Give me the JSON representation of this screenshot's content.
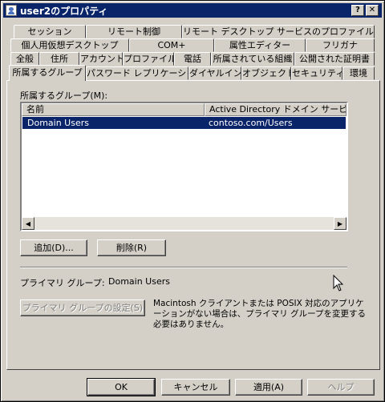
{
  "window": {
    "title": "user2のプロパティ",
    "help_button": "?",
    "close_button": "✕"
  },
  "tabs": {
    "row1": [
      "セッション",
      "リモート制御",
      "リモート デスクトップ サービスのプロファイル"
    ],
    "row2": [
      "個人用仮想デスクトップ",
      "COM+",
      "属性エディター",
      "フリガナ"
    ],
    "row3": [
      "全般",
      "住所",
      "アカウント",
      "プロファイル",
      "電話",
      "所属されている組織",
      "公開された証明書"
    ],
    "row4": [
      "所属するグループ",
      "パスワード レプリケーション",
      "ダイヤルイン",
      "オブジェクト",
      "セキュリティ",
      "環境"
    ],
    "active": "所属するグループ"
  },
  "members": {
    "label": "所属するグループ(M):",
    "columns": [
      "名前",
      "Active Directory ドメイン サービス フォルダー"
    ],
    "rows": [
      {
        "name": "Domain Users",
        "folder": "contoso.com/Users",
        "selected": true
      }
    ]
  },
  "buttons": {
    "add": "追加(D)...",
    "remove": "削除(R)",
    "set_primary": "プライマリ グループの設定(S)",
    "ok": "OK",
    "cancel": "キャンセル",
    "apply": "適用(A)",
    "help": "ヘルプ"
  },
  "primary_group": {
    "label": "プライマリ グループ:",
    "value": "Domain Users",
    "note_line1": "Macintosh クライアントまたは POSIX 対応のアプリケ",
    "note_line2": "ーションがない場合は、プライマリ グループを変更する",
    "note_line3": "必要はありません。"
  }
}
